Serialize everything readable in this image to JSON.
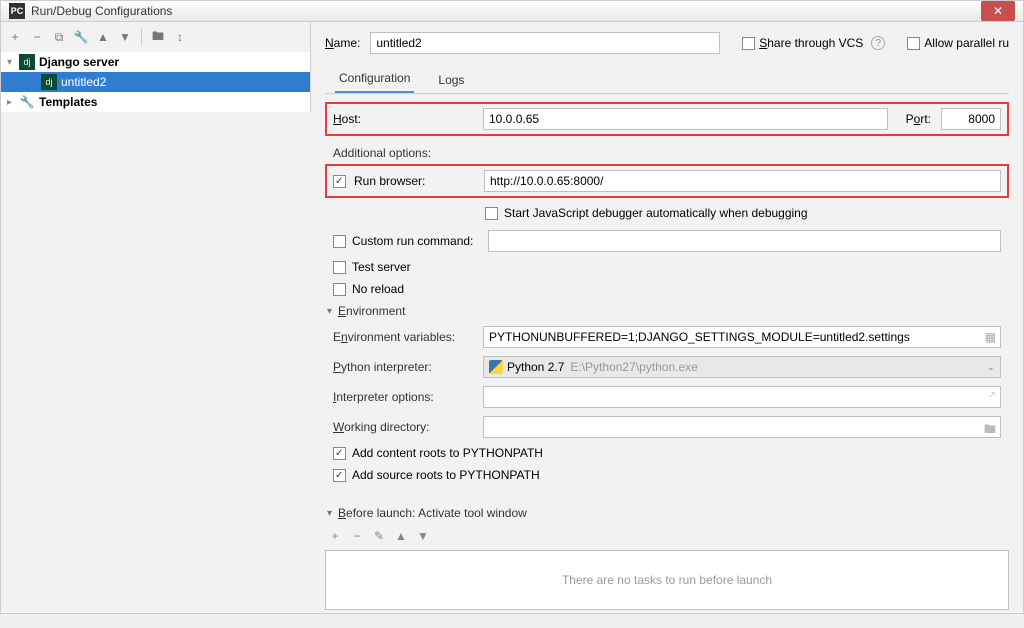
{
  "title": "Run/Debug Configurations",
  "tree": {
    "group1": "Django server",
    "item1": "untitled2",
    "group2": "Templates"
  },
  "name": {
    "label": "Name:",
    "value": "untitled2"
  },
  "share": {
    "label": "Share through VCS"
  },
  "parallel": {
    "label": "Allow parallel ru"
  },
  "tabs": {
    "cfg": "Configuration",
    "logs": "Logs"
  },
  "host": {
    "label": "Host:",
    "value": "10.0.0.65"
  },
  "port": {
    "label": "Port:",
    "value": "8000"
  },
  "addopts": {
    "label": "Additional options:"
  },
  "browser": {
    "label": "Run browser:",
    "value": "http://10.0.0.65:8000/"
  },
  "jsdbg": {
    "label": "Start JavaScript debugger automatically when debugging"
  },
  "customcmd": {
    "label": "Custom run command:"
  },
  "testsrv": {
    "label": "Test server"
  },
  "noreload": {
    "label": "No reload"
  },
  "envhdr": "Environment",
  "envvars": {
    "label": "Environment variables:",
    "value": "PYTHONUNBUFFERED=1;DJANGO_SETTINGS_MODULE=untitled2.settings"
  },
  "interp": {
    "label": "Python interpreter:",
    "name": "Python 2.7",
    "path": "E:\\Python27\\python.exe"
  },
  "interpopts": {
    "label": "Interpreter options:"
  },
  "wdir": {
    "label": "Working directory:"
  },
  "addcontent": {
    "label": "Add content roots to PYTHONPATH"
  },
  "addsource": {
    "label": "Add source roots to PYTHONPATH"
  },
  "blhdr": "Before launch: Activate tool window",
  "notasks": "There are no tasks to run before launch"
}
